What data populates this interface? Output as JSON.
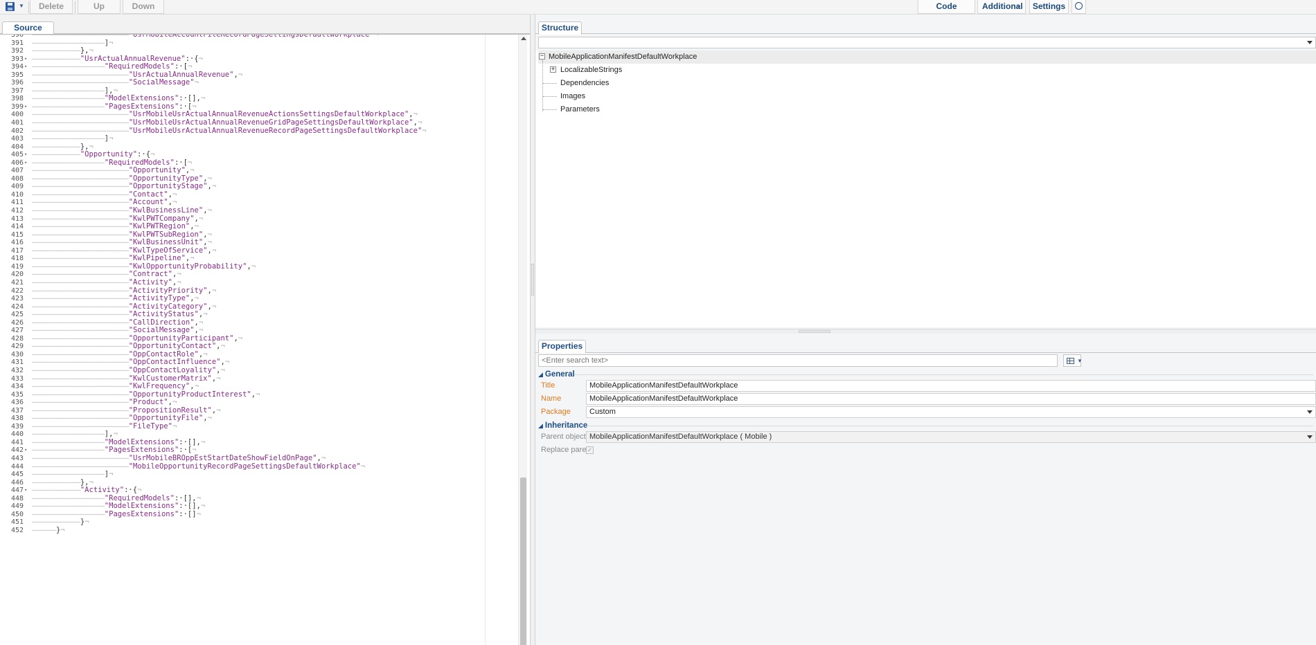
{
  "toolbar": {
    "delete_label": "Delete",
    "up_label": "Up",
    "down_label": "Down",
    "code_validation_label": "Code Validation",
    "additional_label": "Additional",
    "settings_label": "Settings"
  },
  "left_tab": "Source Code",
  "editor": {
    "lines": [
      {
        "n": "390",
        "fold": "",
        "indent": 4,
        "text": "\"UsrMobileAccountFileRecordPageSettingsDefaultWorkplace\"¬"
      },
      {
        "n": "391",
        "fold": "",
        "indent": 3,
        "text": "]¬"
      },
      {
        "n": "392",
        "fold": "",
        "indent": 2,
        "text": "},¬"
      },
      {
        "n": "393",
        "fold": "▾",
        "indent": 2,
        "text": "\"UsrActualAnnualRevenue\":·{¬"
      },
      {
        "n": "394",
        "fold": "▾",
        "indent": 3,
        "text": "\"RequiredModels\":·[¬"
      },
      {
        "n": "395",
        "fold": "",
        "indent": 4,
        "text": "\"UsrActualAnnualRevenue\",¬"
      },
      {
        "n": "396",
        "fold": "",
        "indent": 4,
        "text": "\"SocialMessage\"¬"
      },
      {
        "n": "397",
        "fold": "",
        "indent": 3,
        "text": "],¬"
      },
      {
        "n": "398",
        "fold": "",
        "indent": 3,
        "text": "\"ModelExtensions\":·[],¬"
      },
      {
        "n": "399",
        "fold": "▾",
        "indent": 3,
        "text": "\"PagesExtensions\":·[¬"
      },
      {
        "n": "400",
        "fold": "",
        "indent": 4,
        "text": "\"UsrMobileUsrActualAnnualRevenueActionsSettingsDefaultWorkplace\",¬"
      },
      {
        "n": "401",
        "fold": "",
        "indent": 4,
        "text": "\"UsrMobileUsrActualAnnualRevenueGridPageSettingsDefaultWorkplace\",¬"
      },
      {
        "n": "402",
        "fold": "",
        "indent": 4,
        "text": "\"UsrMobileUsrActualAnnualRevenueRecordPageSettingsDefaultWorkplace\"¬"
      },
      {
        "n": "403",
        "fold": "",
        "indent": 3,
        "text": "]¬"
      },
      {
        "n": "404",
        "fold": "",
        "indent": 2,
        "text": "},¬"
      },
      {
        "n": "405",
        "fold": "▾",
        "indent": 2,
        "text": "\"Opportunity\":·{¬"
      },
      {
        "n": "406",
        "fold": "▾",
        "indent": 3,
        "text": "\"RequiredModels\":·[¬"
      },
      {
        "n": "407",
        "fold": "",
        "indent": 4,
        "text": "\"Opportunity\",¬"
      },
      {
        "n": "408",
        "fold": "",
        "indent": 4,
        "text": "\"OpportunityType\",¬"
      },
      {
        "n": "409",
        "fold": "",
        "indent": 4,
        "text": "\"OpportunityStage\",¬"
      },
      {
        "n": "410",
        "fold": "",
        "indent": 4,
        "text": "\"Contact\",¬"
      },
      {
        "n": "411",
        "fold": "",
        "indent": 4,
        "text": "\"Account\",¬"
      },
      {
        "n": "412",
        "fold": "",
        "indent": 4,
        "text": "\"KwlBusinessLine\",¬"
      },
      {
        "n": "413",
        "fold": "",
        "indent": 4,
        "text": "\"KwlPWTCompany\",¬"
      },
      {
        "n": "414",
        "fold": "",
        "indent": 4,
        "text": "\"KwlPWTRegion\",¬"
      },
      {
        "n": "415",
        "fold": "",
        "indent": 4,
        "text": "\"KwlPWTSubRegion\",¬"
      },
      {
        "n": "416",
        "fold": "",
        "indent": 4,
        "text": "\"KwlBusinessUnit\",¬"
      },
      {
        "n": "417",
        "fold": "",
        "indent": 4,
        "text": "\"KwlTypeOfService\",¬"
      },
      {
        "n": "418",
        "fold": "",
        "indent": 4,
        "text": "\"KwlPipeline\",¬"
      },
      {
        "n": "419",
        "fold": "",
        "indent": 4,
        "text": "\"KwlOpportunityProbability\",¬"
      },
      {
        "n": "420",
        "fold": "",
        "indent": 4,
        "text": "\"Contract\",¬"
      },
      {
        "n": "421",
        "fold": "",
        "indent": 4,
        "text": "\"Activity\",¬"
      },
      {
        "n": "422",
        "fold": "",
        "indent": 4,
        "text": "\"ActivityPriority\",¬"
      },
      {
        "n": "423",
        "fold": "",
        "indent": 4,
        "text": "\"ActivityType\",¬"
      },
      {
        "n": "424",
        "fold": "",
        "indent": 4,
        "text": "\"ActivityCategory\",¬"
      },
      {
        "n": "425",
        "fold": "",
        "indent": 4,
        "text": "\"ActivityStatus\",¬"
      },
      {
        "n": "426",
        "fold": "",
        "indent": 4,
        "text": "\"CallDirection\",¬"
      },
      {
        "n": "427",
        "fold": "",
        "indent": 4,
        "text": "\"SocialMessage\",¬"
      },
      {
        "n": "428",
        "fold": "",
        "indent": 4,
        "text": "\"OpportunityParticipant\",¬"
      },
      {
        "n": "429",
        "fold": "",
        "indent": 4,
        "text": "\"OpportunityContact\",¬"
      },
      {
        "n": "430",
        "fold": "",
        "indent": 4,
        "text": "\"OppContactRole\",¬"
      },
      {
        "n": "431",
        "fold": "",
        "indent": 4,
        "text": "\"OppContactInfluence\",¬"
      },
      {
        "n": "432",
        "fold": "",
        "indent": 4,
        "text": "\"OppContactLoyality\",¬"
      },
      {
        "n": "433",
        "fold": "",
        "indent": 4,
        "text": "\"KwlCustomerMatrix\",¬"
      },
      {
        "n": "434",
        "fold": "",
        "indent": 4,
        "text": "\"KwlFrequency\",¬"
      },
      {
        "n": "435",
        "fold": "",
        "indent": 4,
        "text": "\"OpportunityProductInterest\",¬"
      },
      {
        "n": "436",
        "fold": "",
        "indent": 4,
        "text": "\"Product\",¬"
      },
      {
        "n": "437",
        "fold": "",
        "indent": 4,
        "text": "\"PropositionResult\",¬"
      },
      {
        "n": "438",
        "fold": "",
        "indent": 4,
        "text": "\"OpportunityFile\",¬"
      },
      {
        "n": "439",
        "fold": "",
        "indent": 4,
        "text": "\"FileType\"¬"
      },
      {
        "n": "440",
        "fold": "",
        "indent": 3,
        "text": "],¬"
      },
      {
        "n": "441",
        "fold": "",
        "indent": 3,
        "text": "\"ModelExtensions\":·[],¬"
      },
      {
        "n": "442",
        "fold": "▾",
        "indent": 3,
        "text": "\"PagesExtensions\":·[¬"
      },
      {
        "n": "443",
        "fold": "",
        "indent": 4,
        "text": "\"UsrMobileBROppEstStartDateShowFieldOnPage\",¬"
      },
      {
        "n": "444",
        "fold": "",
        "indent": 4,
        "text": "\"MobileOpportunityRecordPageSettingsDefaultWorkplace\"¬"
      },
      {
        "n": "445",
        "fold": "",
        "indent": 3,
        "text": "]¬"
      },
      {
        "n": "446",
        "fold": "",
        "indent": 2,
        "text": "},¬"
      },
      {
        "n": "447",
        "fold": "▾",
        "indent": 2,
        "text": "\"Activity\":·{¬"
      },
      {
        "n": "448",
        "fold": "",
        "indent": 3,
        "text": "\"RequiredModels\":·[],¬"
      },
      {
        "n": "449",
        "fold": "",
        "indent": 3,
        "text": "\"ModelExtensions\":·[],¬"
      },
      {
        "n": "450",
        "fold": "",
        "indent": 3,
        "text": "\"PagesExtensions\":·[]¬"
      },
      {
        "n": "451",
        "fold": "",
        "indent": 2,
        "text": "}¬"
      },
      {
        "n": "452",
        "fold": "",
        "indent": 1,
        "text": "}¬"
      }
    ]
  },
  "structure": {
    "tab": "Structure",
    "filter_value": "",
    "root": "MobileApplicationManifestDefaultWorkplace",
    "children": [
      "LocalizableStrings",
      "Dependencies",
      "Images",
      "Parameters"
    ]
  },
  "properties": {
    "tab": "Properties",
    "search_placeholder": "<Enter search text>",
    "general_header": "General",
    "title_label": "Title",
    "title_value": "MobileApplicationManifestDefaultWorkplace",
    "name_label": "Name",
    "name_value": "MobileApplicationManifestDefaultWorkplace",
    "package_label": "Package",
    "package_value": "Custom",
    "inheritance_header": "Inheritance",
    "parent_label": "Parent object",
    "parent_value": "MobileApplicationManifestDefaultWorkplace ( Mobile )",
    "replace_parent_label": "Replace parent",
    "replace_parent_checked": true
  },
  "colors": {
    "accent": "#1e4e86",
    "string": "#8a2c8a",
    "required_label": "#e07b1f"
  }
}
